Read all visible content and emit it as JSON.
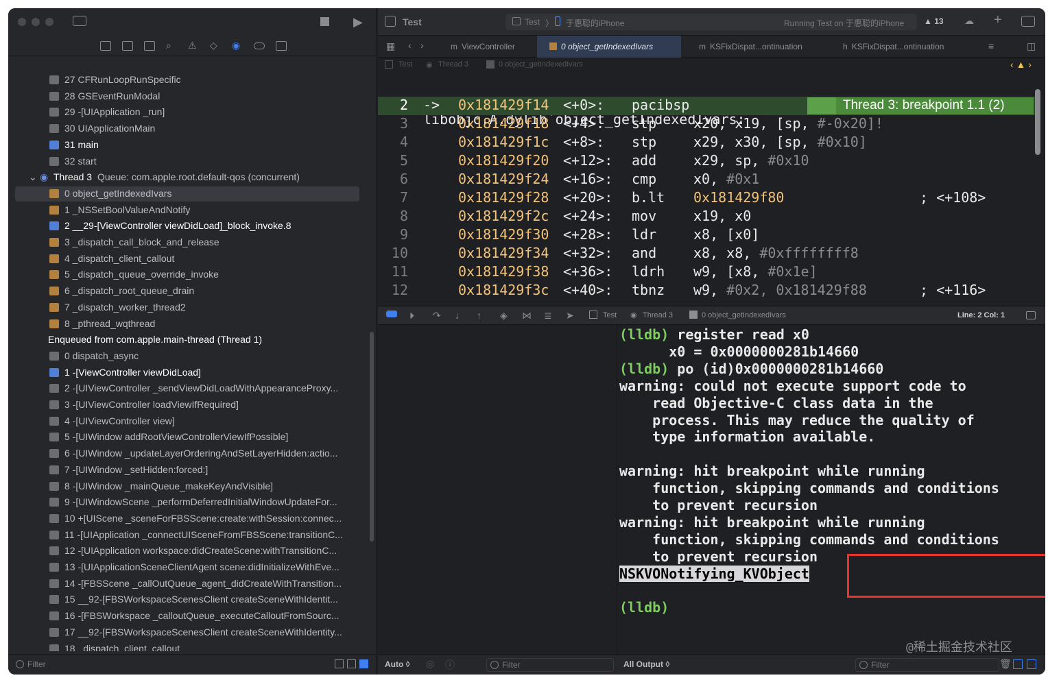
{
  "left": {
    "filter_placeholder": "Filter",
    "frames_top": [
      {
        "text": "27 CFRunLoopRunSpecific",
        "bold": false
      },
      {
        "text": "28 GSEventRunModal",
        "bold": false
      },
      {
        "text": "29 -[UIApplication _run]",
        "bold": false
      },
      {
        "text": "30 UIApplicationMain",
        "bold": false
      },
      {
        "text": "31 main",
        "bold": true
      },
      {
        "text": "32 start",
        "bold": false
      }
    ],
    "thread_header": {
      "name": "Thread 3",
      "queue": "Queue: com.apple.root.default-qos (concurrent)"
    },
    "frames_thread3": [
      {
        "text": "0 object_getIndexedIvars",
        "bold": false,
        "selected": true
      },
      {
        "text": "1 _NSSetBoolValueAndNotify",
        "bold": false
      },
      {
        "text": "2 __29-[ViewController viewDidLoad]_block_invoke.8",
        "bold": true
      },
      {
        "text": "3 _dispatch_call_block_and_release",
        "bold": false
      },
      {
        "text": "4 _dispatch_client_callout",
        "bold": false
      },
      {
        "text": "5 _dispatch_queue_override_invoke",
        "bold": false
      },
      {
        "text": "6 _dispatch_root_queue_drain",
        "bold": false
      },
      {
        "text": "7 _dispatch_worker_thread2",
        "bold": false
      },
      {
        "text": "8 _pthread_wqthread",
        "bold": false
      }
    ],
    "enqueued_header": "Enqueued from com.apple.main-thread (Thread 1)",
    "frames_enqueued": [
      {
        "text": "0 dispatch_async",
        "bold": false
      },
      {
        "text": "1 -[ViewController viewDidLoad]",
        "bold": true
      },
      {
        "text": "2 -[UIViewController _sendViewDidLoadWithAppearanceProxy...",
        "bold": false
      },
      {
        "text": "3 -[UIViewController loadViewIfRequired]",
        "bold": false
      },
      {
        "text": "4 -[UIViewController view]",
        "bold": false
      },
      {
        "text": "5 -[UIWindow addRootViewControllerViewIfPossible]",
        "bold": false
      },
      {
        "text": "6 -[UIWindow _updateLayerOrderingAndSetLayerHidden:actio...",
        "bold": false
      },
      {
        "text": "7 -[UIWindow _setHidden:forced:]",
        "bold": false
      },
      {
        "text": "8 -[UIWindow _mainQueue_makeKeyAndVisible]",
        "bold": false
      },
      {
        "text": "9 -[UIWindowScene _performDeferredInitialWindowUpdateFor...",
        "bold": false
      },
      {
        "text": "10 +[UIScene _sceneForFBSScene:create:withSession:connec...",
        "bold": false
      },
      {
        "text": "11 -[UIApplication _connectUISceneFromFBSScene:transitionC...",
        "bold": false
      },
      {
        "text": "12 -[UIApplication workspace:didCreateScene:withTransitionC...",
        "bold": false
      },
      {
        "text": "13 -[UIApplicationSceneClientAgent scene:didInitializeWithEve...",
        "bold": false
      },
      {
        "text": "14 -[FBSScene _callOutQueue_agent_didCreateWithTransition...",
        "bold": false
      },
      {
        "text": "15 __92-[FBSWorkspaceScenesClient createSceneWithIdentit...",
        "bold": false
      },
      {
        "text": "16 -[FBSWorkspace _calloutQueue_executeCalloutFromSourc...",
        "bold": false
      },
      {
        "text": "17 __92-[FBSWorkspaceScenesClient createSceneWithIdentity...",
        "bold": false
      },
      {
        "text": "18 _dispatch_client_callout",
        "bold": false
      }
    ]
  },
  "toolbar": {
    "project": "Test",
    "scheme": "Test",
    "device": "于惠聪的iPhone",
    "status": "Running Test on 于惠聪的iPhone",
    "warnings": "13"
  },
  "tabs": [
    {
      "label": "ViewController",
      "prefix": "m",
      "active": false
    },
    {
      "label": "0 object_getIndexedIvars",
      "prefix": "",
      "active": true
    },
    {
      "label": "KSFixDispat...ontinuation",
      "prefix": "m",
      "active": false
    },
    {
      "label": "KSFixDispat...ontinuation",
      "prefix": "h",
      "active": false
    }
  ],
  "jumpbar": [
    "Test",
    "Thread 3",
    "0 object_getIndexedIvars"
  ],
  "code": {
    "header": "libobjc.A.dylib`object_getIndexedIvars:",
    "current_line": 2,
    "lines": [
      {
        "n": "2",
        "arrow": "->",
        "addr": "0x181429f14",
        "off": "<+0>:",
        "op": "pacibsp",
        "args": "",
        "imm": "",
        "cmt": ""
      },
      {
        "n": "3",
        "arrow": "",
        "addr": "0x181429f18",
        "off": "<+4>:",
        "op": "stp",
        "args": "x20, x19, [sp, ",
        "imm": "#-0x20]!",
        "cmt": ""
      },
      {
        "n": "4",
        "arrow": "",
        "addr": "0x181429f1c",
        "off": "<+8>:",
        "op": "stp",
        "args": "x29, x30, [sp, ",
        "imm": "#0x10]",
        "cmt": ""
      },
      {
        "n": "5",
        "arrow": "",
        "addr": "0x181429f20",
        "off": "<+12>:",
        "op": "add",
        "args": "x29, sp, ",
        "imm": "#0x10",
        "cmt": ""
      },
      {
        "n": "6",
        "arrow": "",
        "addr": "0x181429f24",
        "off": "<+16>:",
        "op": "cmp",
        "args": "x0, ",
        "imm": "#0x1",
        "cmt": ""
      },
      {
        "n": "7",
        "arrow": "",
        "addr": "0x181429f28",
        "off": "<+20>:",
        "op": "b.lt",
        "args": "0x181429f80",
        "imm": "",
        "cmt": "; <+108>"
      },
      {
        "n": "8",
        "arrow": "",
        "addr": "0x181429f2c",
        "off": "<+24>:",
        "op": "mov",
        "args": "x19, x0",
        "imm": "",
        "cmt": ""
      },
      {
        "n": "9",
        "arrow": "",
        "addr": "0x181429f30",
        "off": "<+28>:",
        "op": "ldr",
        "args": "x8, [x0]",
        "imm": "",
        "cmt": ""
      },
      {
        "n": "10",
        "arrow": "",
        "addr": "0x181429f34",
        "off": "<+32>:",
        "op": "and",
        "args": "x8, x8, ",
        "imm": "#0xffffffff8",
        "cmt": ""
      },
      {
        "n": "11",
        "arrow": "",
        "addr": "0x181429f38",
        "off": "<+36>:",
        "op": "ldrh",
        "args": "w9, [x8, ",
        "imm": "#0x1e]",
        "cmt": ""
      },
      {
        "n": "12",
        "arrow": "",
        "addr": "0x181429f3c",
        "off": "<+40>:",
        "op": "tbnz",
        "args": "w9, ",
        "imm": "#0x2, 0x181429f88",
        "cmt": "; <+116>"
      }
    ],
    "breakpoint_label": "Thread 3: breakpoint 1.1 (2)"
  },
  "debugbar": {
    "path": [
      "Test",
      "Thread 3",
      "0 object_getIndexedIvars"
    ],
    "line_col": "Line: 2  Col: 1"
  },
  "console": {
    "lines": [
      {
        "type": "prompt",
        "prompt": "(lldb)",
        "text": " register read x0"
      },
      {
        "type": "text",
        "text": "      x0 = 0x0000000281b14660"
      },
      {
        "type": "prompt",
        "prompt": "(lldb)",
        "text": " po (id)0x0000000281b14660"
      },
      {
        "type": "text",
        "text": "warning: could not execute support code to"
      },
      {
        "type": "text",
        "text": "    read Objective-C class data in the"
      },
      {
        "type": "text",
        "text": "    process. This may reduce the quality of"
      },
      {
        "type": "text",
        "text": "    type information available."
      },
      {
        "type": "text",
        "text": ""
      },
      {
        "type": "text",
        "text": "warning: hit breakpoint while running"
      },
      {
        "type": "text",
        "text": "    function, skipping commands and conditions"
      },
      {
        "type": "text",
        "text": "    to prevent recursion"
      },
      {
        "type": "text",
        "text": "warning: hit breakpoint while running"
      },
      {
        "type": "text",
        "text": "    function, skipping commands and conditions"
      },
      {
        "type": "text",
        "text": "    to prevent recursion"
      },
      {
        "type": "highlight",
        "text": "NSKVONotifying_KVObject"
      },
      {
        "type": "text",
        "text": ""
      },
      {
        "type": "prompt",
        "prompt": "(lldb)",
        "text": ""
      }
    ],
    "watermark": "@稀土掘金技术社区"
  },
  "bottom": {
    "auto_label": "Auto ◊",
    "filter_placeholder": "Filter",
    "output_label": "All Output ◊",
    "console_filter_placeholder": "Filter"
  },
  "colors": {
    "accent": "#4a8a3a",
    "address": "#f1c278",
    "prompt": "#7ccf5f",
    "annotation": "#e8342a"
  }
}
